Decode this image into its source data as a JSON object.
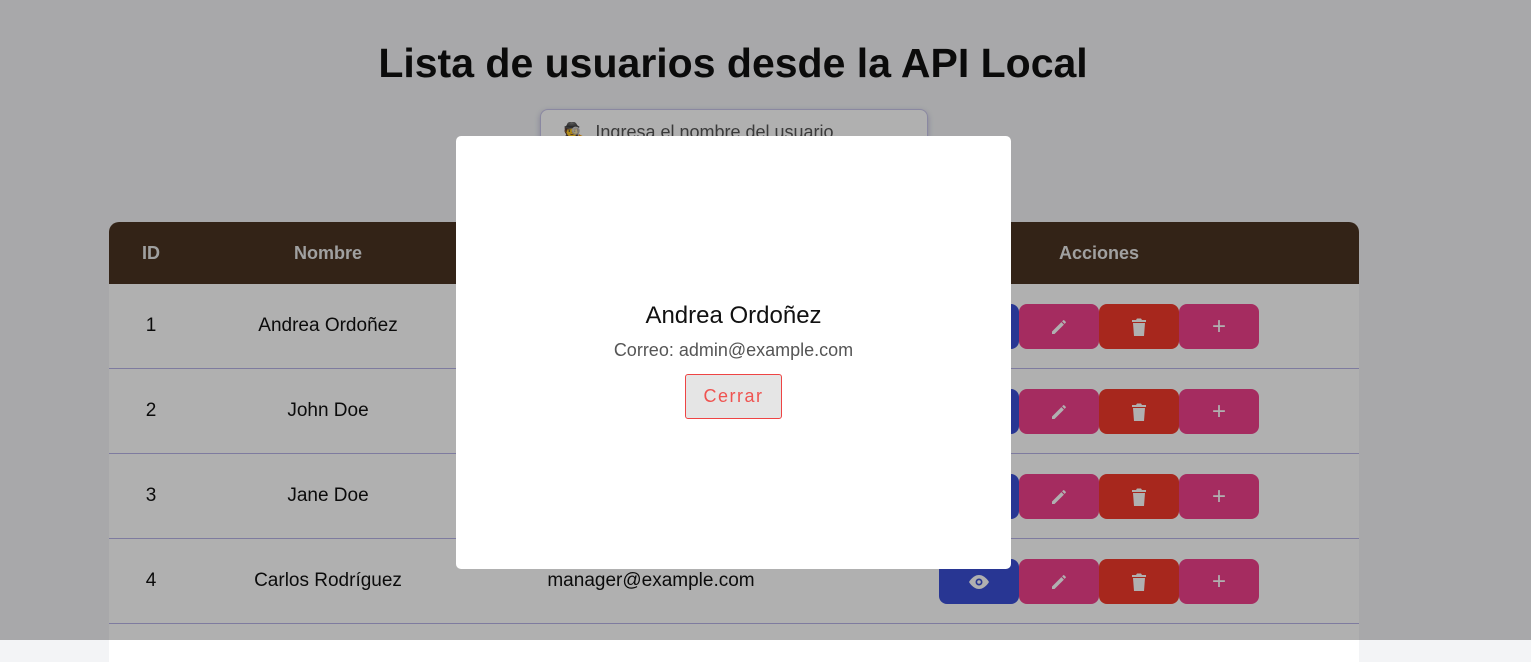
{
  "page": {
    "title": "Lista de usuarios desde la API Local"
  },
  "search": {
    "placeholder": "Ingresa el nombre del usuario",
    "value": ""
  },
  "table": {
    "headers": {
      "id": "ID",
      "name": "Nombre",
      "actions": "Acciones"
    },
    "rows": [
      {
        "id": "1",
        "name": "Andrea Ordoñez",
        "email": ""
      },
      {
        "id": "2",
        "name": "John Doe",
        "email": ""
      },
      {
        "id": "3",
        "name": "Jane Doe",
        "email": ""
      },
      {
        "id": "4",
        "name": "Carlos Rodríguez",
        "email": "manager@example.com"
      }
    ],
    "add_label": "+"
  },
  "modal": {
    "name": "Andrea Ordoñez",
    "email_text": "Correo: admin@example.com",
    "close_label": "Cerrar"
  },
  "colors": {
    "header_bg": "#4a3322",
    "view_button": "#3b4fd6",
    "edit_button": "#f0418c",
    "delete_button": "#f2392b",
    "add_button": "#f0418c",
    "close_text": "#ef5350"
  },
  "icons": {
    "search": "spy-icon",
    "view": "eye-icon",
    "edit": "pencil-icon",
    "delete": "trash-icon",
    "add": "plus-icon"
  }
}
